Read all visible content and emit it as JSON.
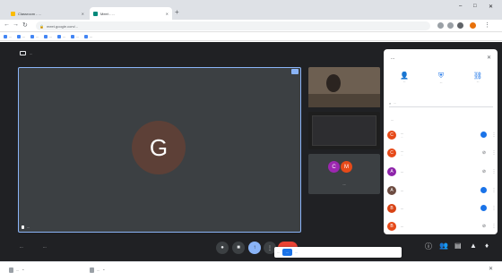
{
  "browser": {
    "tabs": [
      {
        "title": "Classroom - ...",
        "active": false
      },
      {
        "title": "Meet - ...",
        "active": true
      }
    ],
    "new_tab_icon": "plus-icon",
    "window_controls": [
      "minimize-icon",
      "maximize-icon",
      "close-icon"
    ],
    "url": "meet.google.com/...",
    "bookmarks": [
      "...",
      "...",
      "...",
      "...",
      "...",
      "...",
      "..."
    ]
  },
  "meet": {
    "presentation_title": "...",
    "main_tile": {
      "initial": "G",
      "name": "..."
    },
    "thumbnails": {
      "third_tile_initials": [
        "C",
        "M"
      ],
      "third_tile_label": "..."
    },
    "bottom_bar": {
      "time": "...",
      "meeting_code": "...",
      "share_banner_text": "...",
      "share_banner_button": "...",
      "share_banner_hide": "..."
    }
  },
  "people_panel": {
    "title": "...",
    "actions": [
      "...",
      "...",
      "..."
    ],
    "search_placeholder": "...",
    "section_label": "...",
    "participants": [
      {
        "initial": "C",
        "name": "...",
        "sub": "...",
        "color": "#e64a19"
      },
      {
        "initial": "C",
        "name": "...",
        "sub": "...",
        "color": "#e64a19"
      },
      {
        "initial": "A",
        "name": "...",
        "sub": "",
        "color": "#8e24aa"
      },
      {
        "initial": "A",
        "name": "...",
        "sub": "",
        "color": "#6d4c41"
      },
      {
        "initial": "B",
        "name": "...",
        "sub": "",
        "color": "#d84315"
      },
      {
        "initial": "B",
        "name": "...",
        "sub": "",
        "color": "#e64a19"
      }
    ]
  },
  "downloads": [
    "...",
    "..."
  ],
  "colors": {
    "meet_bg": "#202124",
    "accent": "#8ab4f8",
    "end_call": "#ea4335",
    "primary_blue": "#1a73e8"
  }
}
